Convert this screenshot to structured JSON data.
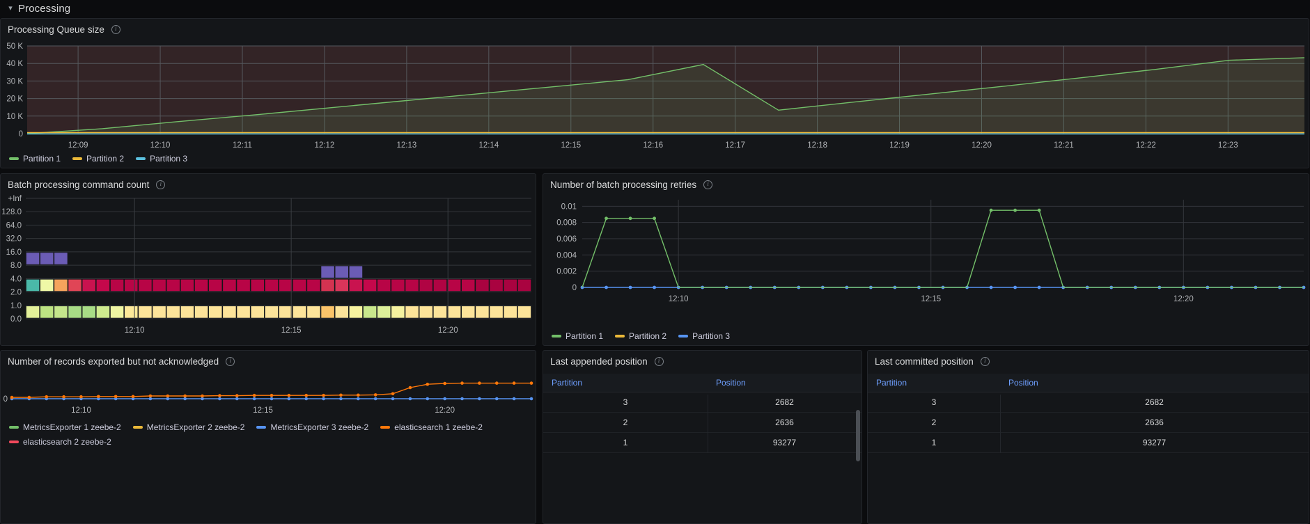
{
  "section": {
    "title": "Processing",
    "collapse_icon": "chevron-down-icon"
  },
  "panels": {
    "queue": {
      "title": "Processing Queue size",
      "info_icon": "info-icon",
      "y_ticks": [
        "50 K",
        "40 K",
        "30 K",
        "20 K",
        "10 K",
        "0"
      ],
      "x_ticks": [
        "12:09",
        "12:10",
        "12:11",
        "12:12",
        "12:13",
        "12:14",
        "12:15",
        "12:16",
        "12:17",
        "12:18",
        "12:19",
        "12:20",
        "12:21",
        "12:22",
        "12:23"
      ],
      "legend": [
        {
          "label": "Partition 1",
          "color": "#73bf69"
        },
        {
          "label": "Partition 2",
          "color": "#eab839"
        },
        {
          "label": "Partition 3",
          "color": "#5bc0de"
        }
      ]
    },
    "batch": {
      "title": "Batch processing command count",
      "info_icon": "info-icon",
      "y_ticks": [
        "+Inf",
        "128.0",
        "64.0",
        "32.0",
        "16.0",
        "8.0",
        "4.0",
        "2.0",
        "1.0",
        "0.0"
      ],
      "x_ticks": [
        "12:10",
        "12:15",
        "12:20"
      ]
    },
    "retries": {
      "title": "Number of batch processing retries",
      "info_icon": "info-icon",
      "y_ticks": [
        "0.01",
        "0.008",
        "0.006",
        "0.004",
        "0.002",
        "0"
      ],
      "x_ticks": [
        "12:10",
        "12:15",
        "12:20"
      ],
      "legend": [
        {
          "label": "Partition 1",
          "color": "#73bf69"
        },
        {
          "label": "Partition 2",
          "color": "#eab839"
        },
        {
          "label": "Partition 3",
          "color": "#5794f2"
        }
      ]
    },
    "exported": {
      "title": "Number of records exported but not acknowledged",
      "info_icon": "info-icon",
      "y_ticks": [
        "0"
      ],
      "x_ticks": [
        "12:10",
        "12:15",
        "12:20"
      ],
      "legend": [
        {
          "label": "MetricsExporter 1 zeebe-2",
          "color": "#73bf69"
        },
        {
          "label": "MetricsExporter 2 zeebe-2",
          "color": "#eab839"
        },
        {
          "label": "MetricsExporter 3 zeebe-2",
          "color": "#5794f2"
        },
        {
          "label": "elasticsearch 1 zeebe-2",
          "color": "#ff780a"
        },
        {
          "label": "elasticsearch 2 zeebe-2",
          "color": "#f2495c"
        }
      ]
    },
    "appended": {
      "title": "Last appended position",
      "info_icon": "info-icon",
      "columns": [
        "Partition",
        "Position"
      ],
      "rows": [
        {
          "partition": "3",
          "position": "2682"
        },
        {
          "partition": "2",
          "position": "2636"
        },
        {
          "partition": "1",
          "position": "93277"
        }
      ]
    },
    "committed": {
      "title": "Last committed position",
      "info_icon": "info-icon",
      "columns": [
        "Partition",
        "Position"
      ],
      "rows": [
        {
          "partition": "3",
          "position": "2682"
        },
        {
          "partition": "2",
          "position": "2636"
        },
        {
          "partition": "1",
          "position": "93277"
        }
      ]
    }
  },
  "chart_data": [
    {
      "id": "queue",
      "type": "line",
      "title": "Processing Queue size",
      "xlabel": "",
      "ylabel": "",
      "ylim": [
        0,
        52000
      ],
      "grid": true,
      "legend_position": "bottom",
      "x": [
        "12:08:30",
        "12:09",
        "12:10",
        "12:11",
        "12:12",
        "12:13",
        "12:14",
        "12:15",
        "12:16",
        "12:16:30",
        "12:17",
        "12:18",
        "12:19",
        "12:20",
        "12:21",
        "12:22",
        "12:23",
        "12:23:30"
      ],
      "series": [
        {
          "name": "Partition 1",
          "color": "#73bf69",
          "values": [
            0,
            2900,
            7100,
            11000,
            15200,
            19400,
            23600,
            27800,
            32000,
            41000,
            13900,
            18700,
            23400,
            28100,
            33000,
            38000,
            43500,
            45000
          ]
        },
        {
          "name": "Partition 2",
          "color": "#eab839",
          "values": [
            0,
            0,
            0,
            0,
            0,
            0,
            0,
            0,
            0,
            0,
            0,
            0,
            0,
            0,
            0,
            0,
            0,
            0
          ]
        },
        {
          "name": "Partition 3",
          "color": "#5bc0de",
          "values": [
            0,
            0,
            0,
            0,
            0,
            0,
            0,
            0,
            0,
            0,
            0,
            0,
            0,
            0,
            0,
            0,
            0,
            0
          ]
        }
      ]
    },
    {
      "id": "batch",
      "type": "heatmap",
      "title": "Batch processing command count",
      "y_buckets": [
        "+Inf",
        "128.0",
        "64.0",
        "32.0",
        "16.0",
        "8.0",
        "4.0",
        "2.0",
        "1.0",
        "0.0"
      ],
      "x_ticks": [
        "12:10",
        "12:15",
        "12:20"
      ],
      "rows": [
        {
          "bucket": "8.0-16.0",
          "cells": [
            {
              "i": 0,
              "color": "#6b5cb5"
            },
            {
              "i": 1,
              "color": "#6b5cb5"
            },
            {
              "i": 2,
              "color": "#6b5cb5"
            }
          ]
        },
        {
          "bucket": "4.0-8.0",
          "cells": [
            {
              "i": 21,
              "color": "#6b5cb5"
            },
            {
              "i": 22,
              "color": "#6b5cb5"
            },
            {
              "i": 23,
              "color": "#6b5cb5"
            }
          ]
        },
        {
          "bucket": "2.0-4.0",
          "cells": [
            {
              "i": 0,
              "color": "#4ab9a9"
            },
            {
              "i": 1,
              "color": "#eff8a6"
            },
            {
              "i": 2,
              "color": "#f5a35c"
            },
            {
              "i": 3,
              "color": "#e04556"
            },
            {
              "i": 4,
              "color": "#c9134f"
            },
            {
              "i": 5,
              "color": "#c4084b"
            },
            {
              "i": 6,
              "color": "#b80546"
            },
            {
              "i": 7,
              "color": "#b80546"
            },
            {
              "i": 8,
              "color": "#b80546"
            },
            {
              "i": 9,
              "color": "#b80546"
            },
            {
              "i": 10,
              "color": "#b80546"
            },
            {
              "i": 11,
              "color": "#b80546"
            },
            {
              "i": 12,
              "color": "#b80546"
            },
            {
              "i": 13,
              "color": "#b80546"
            },
            {
              "i": 14,
              "color": "#b80546"
            },
            {
              "i": 15,
              "color": "#b80546"
            },
            {
              "i": 16,
              "color": "#b80546"
            },
            {
              "i": 17,
              "color": "#b80546"
            },
            {
              "i": 18,
              "color": "#b80546"
            },
            {
              "i": 19,
              "color": "#b80546"
            },
            {
              "i": 20,
              "color": "#b80546"
            },
            {
              "i": 21,
              "color": "#d43351"
            },
            {
              "i": 22,
              "color": "#d9355a"
            },
            {
              "i": 23,
              "color": "#c9134f"
            },
            {
              "i": 24,
              "color": "#c4084b"
            },
            {
              "i": 25,
              "color": "#b80546"
            },
            {
              "i": 26,
              "color": "#b80546"
            },
            {
              "i": 27,
              "color": "#b80546"
            },
            {
              "i": 28,
              "color": "#b00443"
            },
            {
              "i": 29,
              "color": "#b00443"
            },
            {
              "i": 30,
              "color": "#b80546"
            },
            {
              "i": 31,
              "color": "#b80546"
            },
            {
              "i": 32,
              "color": "#a90340"
            },
            {
              "i": 33,
              "color": "#a90340"
            },
            {
              "i": 34,
              "color": "#a90340"
            },
            {
              "i": 35,
              "color": "#a90340"
            }
          ]
        },
        {
          "bucket": "0.0-1.0",
          "cells": [
            {
              "i": 0,
              "color": "#e3f09a"
            },
            {
              "i": 1,
              "color": "#bde383"
            },
            {
              "i": 2,
              "color": "#c5e68c"
            },
            {
              "i": 3,
              "color": "#a8dc86"
            },
            {
              "i": 4,
              "color": "#a8dc86"
            },
            {
              "i": 5,
              "color": "#cfeb8f"
            },
            {
              "i": 6,
              "color": "#eff5a3"
            },
            {
              "i": 7,
              "color": "#fde99a"
            },
            {
              "i": 8,
              "color": "#fde49a"
            },
            {
              "i": 9,
              "color": "#fde49a"
            },
            {
              "i": 10,
              "color": "#fde49a"
            },
            {
              "i": 11,
              "color": "#fde49a"
            },
            {
              "i": 12,
              "color": "#fde49a"
            },
            {
              "i": 13,
              "color": "#fde49a"
            },
            {
              "i": 14,
              "color": "#fde49a"
            },
            {
              "i": 15,
              "color": "#fde49a"
            },
            {
              "i": 16,
              "color": "#fde49a"
            },
            {
              "i": 17,
              "color": "#fde49a"
            },
            {
              "i": 18,
              "color": "#fde49a"
            },
            {
              "i": 19,
              "color": "#fde49a"
            },
            {
              "i": 20,
              "color": "#fde49a"
            },
            {
              "i": 21,
              "color": "#fbc46a"
            },
            {
              "i": 22,
              "color": "#fde49a"
            },
            {
              "i": 23,
              "color": "#f7f3a0"
            },
            {
              "i": 24,
              "color": "#c9e88c"
            },
            {
              "i": 25,
              "color": "#ddf09a"
            },
            {
              "i": 26,
              "color": "#f5f2a0"
            },
            {
              "i": 27,
              "color": "#fde49a"
            },
            {
              "i": 28,
              "color": "#fde49a"
            },
            {
              "i": 29,
              "color": "#fde49a"
            },
            {
              "i": 30,
              "color": "#fde49a"
            },
            {
              "i": 31,
              "color": "#fde49a"
            },
            {
              "i": 32,
              "color": "#fde49a"
            },
            {
              "i": 33,
              "color": "#fde49a"
            },
            {
              "i": 34,
              "color": "#fde49a"
            },
            {
              "i": 35,
              "color": "#fde49a"
            }
          ]
        }
      ]
    },
    {
      "id": "retries",
      "type": "line",
      "title": "Number of batch processing retries",
      "ylim": [
        0,
        0.0108
      ],
      "y_ticks": [
        0,
        0.002,
        0.004,
        0.006,
        0.008,
        0.01
      ],
      "grid": true,
      "legend_position": "bottom",
      "n_points": 31,
      "series": [
        {
          "name": "Partition 1",
          "color": "#73bf69",
          "values": [
            0,
            0.0085,
            0.0085,
            0.0085,
            0,
            0,
            0,
            0,
            0,
            0,
            0,
            0,
            0,
            0,
            0,
            0,
            0,
            0.0095,
            0.0095,
            0.0095,
            0,
            0,
            0,
            0,
            0,
            0,
            0,
            0,
            0,
            0,
            0
          ]
        },
        {
          "name": "Partition 2",
          "color": "#eab839",
          "values": [
            0,
            0,
            0,
            0,
            0,
            0,
            0,
            0,
            0,
            0,
            0,
            0,
            0,
            0,
            0,
            0,
            0,
            0,
            0,
            0,
            0,
            0,
            0,
            0,
            0,
            0,
            0,
            0,
            0,
            0,
            0
          ]
        },
        {
          "name": "Partition 3",
          "color": "#5794f2",
          "values": [
            0,
            0,
            0,
            0,
            0,
            0,
            0,
            0,
            0,
            0,
            0,
            0,
            0,
            0,
            0,
            0,
            0,
            0,
            0,
            0,
            0,
            0,
            0,
            0,
            0,
            0,
            0,
            0,
            0,
            0,
            0
          ]
        }
      ]
    },
    {
      "id": "exported",
      "type": "line",
      "title": "Number of records exported but not acknowledged",
      "ylim": [
        0,
        1
      ],
      "y_ticks": [
        0
      ],
      "grid": false,
      "legend_position": "bottom",
      "n_points": 31,
      "series": [
        {
          "name": "MetricsExporter 1 zeebe-2",
          "color": "#73bf69",
          "values": [
            0,
            0,
            0,
            0,
            0,
            0,
            0,
            0,
            0,
            0,
            0,
            0,
            0,
            0,
            0,
            0,
            0,
            0,
            0,
            0,
            0,
            0,
            0,
            0,
            0,
            0,
            0,
            0,
            0,
            0,
            0
          ]
        },
        {
          "name": "MetricsExporter 2 zeebe-2",
          "color": "#eab839",
          "values": [
            0,
            0,
            0,
            0,
            0,
            0,
            0,
            0,
            0,
            0,
            0,
            0,
            0,
            0,
            0,
            0,
            0,
            0,
            0,
            0,
            0,
            0,
            0,
            0,
            0,
            0,
            0,
            0,
            0,
            0,
            0
          ]
        },
        {
          "name": "MetricsExporter 3 zeebe-2",
          "color": "#5794f2",
          "values": [
            0,
            0,
            0,
            0,
            0,
            0,
            0,
            0,
            0,
            0,
            0,
            0,
            0,
            0,
            0,
            0,
            0,
            0,
            0,
            0,
            0,
            0,
            0,
            0,
            0,
            0,
            0,
            0,
            0,
            0,
            0
          ]
        },
        {
          "name": "elasticsearch 1 zeebe-2",
          "color": "#ff780a",
          "values": [
            0.05,
            0.05,
            0.07,
            0.07,
            0.07,
            0.08,
            0.08,
            0.08,
            0.1,
            0.1,
            0.1,
            0.1,
            0.11,
            0.11,
            0.12,
            0.12,
            0.12,
            0.12,
            0.12,
            0.13,
            0.13,
            0.14,
            0.18,
            0.4,
            0.52,
            0.55,
            0.56,
            0.56,
            0.56,
            0.56,
            0.56
          ]
        },
        {
          "name": "elasticsearch 2 zeebe-2",
          "color": "#f2495c",
          "values": [
            0,
            0,
            0,
            0,
            0,
            0,
            0,
            0,
            0,
            0,
            0,
            0,
            0,
            0,
            0,
            0,
            0,
            0,
            0,
            0,
            0,
            0,
            0,
            0,
            0,
            0,
            0,
            0,
            0,
            0,
            0
          ]
        }
      ]
    },
    {
      "id": "appended",
      "type": "table",
      "title": "Last appended position",
      "columns": [
        "Partition",
        "Position"
      ],
      "rows": [
        [
          "3",
          "2682"
        ],
        [
          "2",
          "2636"
        ],
        [
          "1",
          "93277"
        ]
      ]
    },
    {
      "id": "committed",
      "type": "table",
      "title": "Last committed position",
      "columns": [
        "Partition",
        "Position"
      ],
      "rows": [
        [
          "3",
          "2682"
        ],
        [
          "2",
          "2636"
        ],
        [
          "1",
          "93277"
        ]
      ]
    }
  ]
}
